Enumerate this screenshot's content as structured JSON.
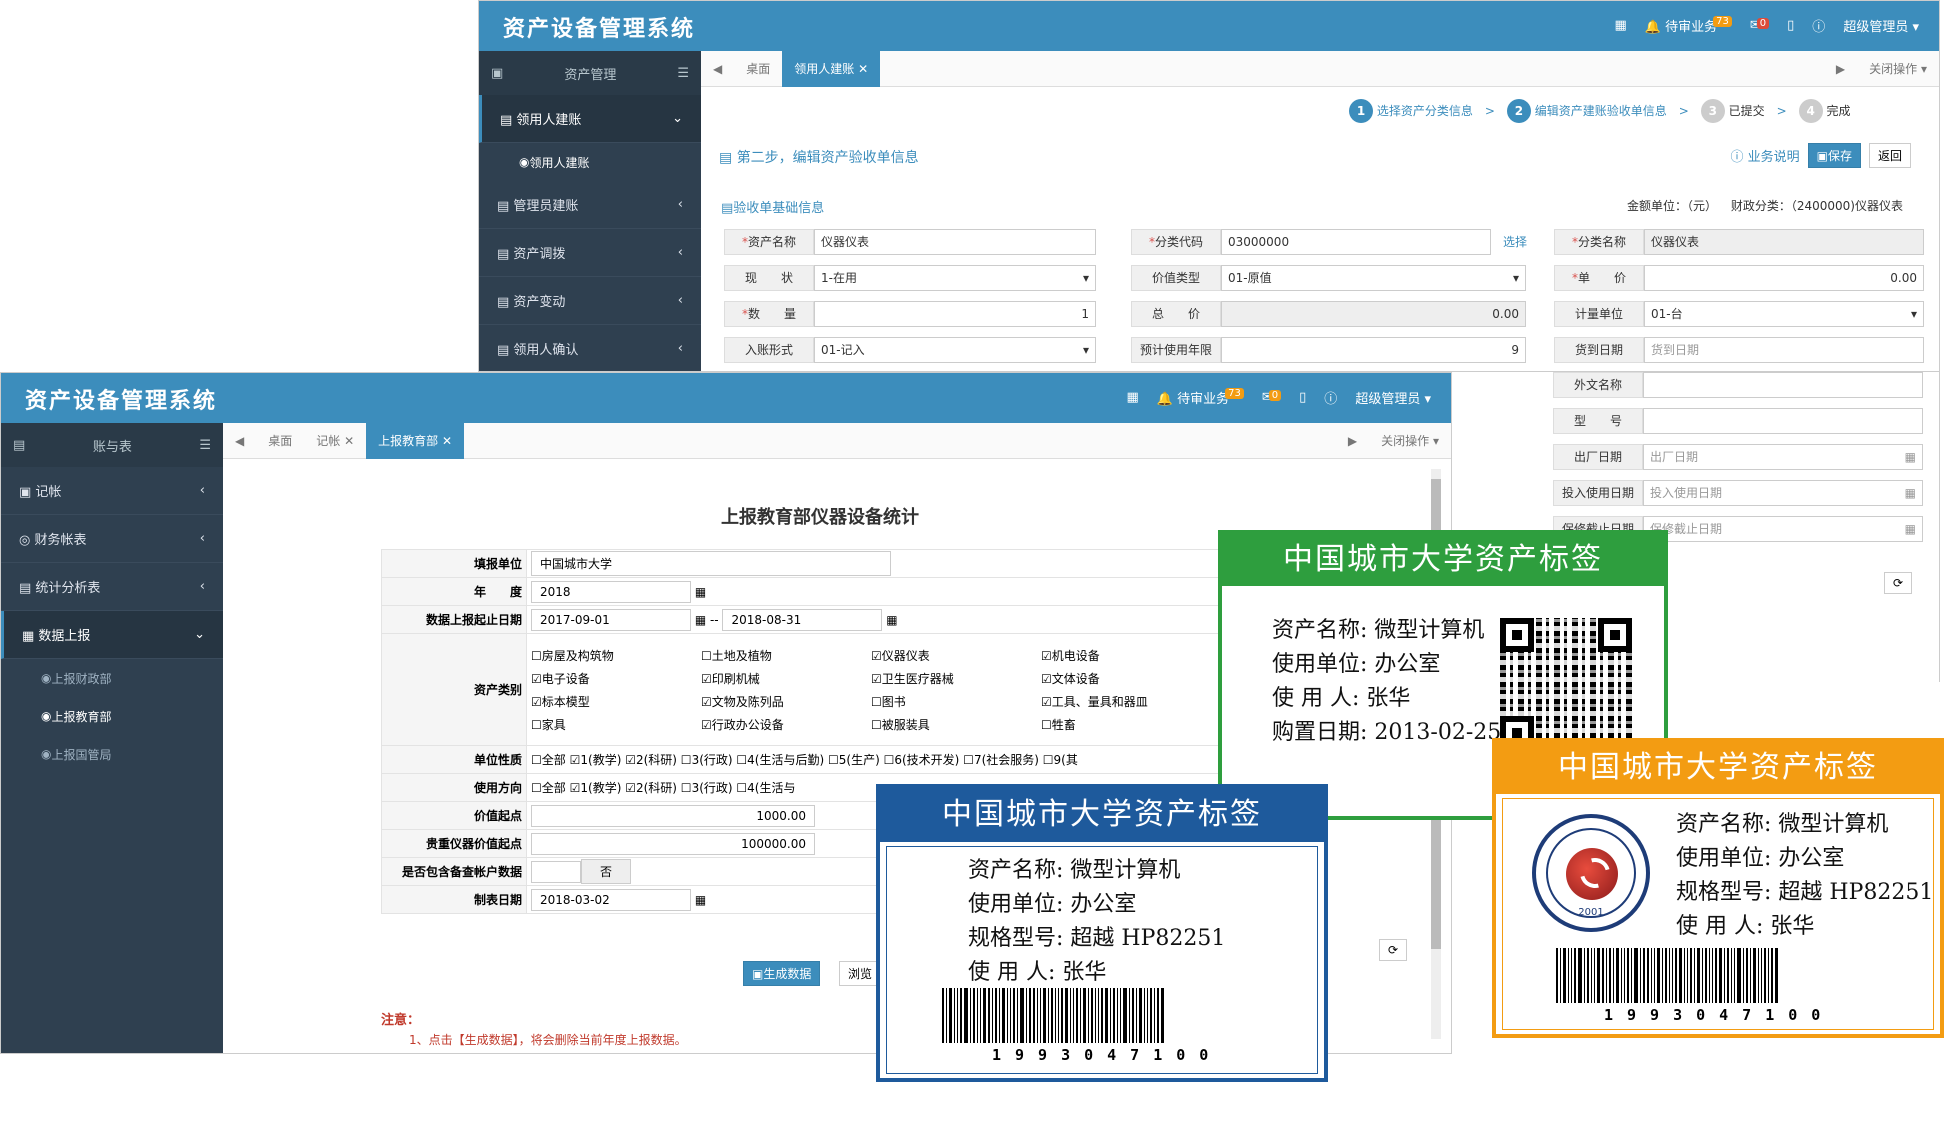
{
  "back": {
    "app_title": "资产设备管理系统",
    "pending": "待审业务",
    "pending_count": "73",
    "mail_count": "0",
    "user": "超级管理员",
    "sidebar_head": "资产管理",
    "sidebar": [
      {
        "label": "领用人建账",
        "sub": [
          "领用人建账"
        ]
      },
      {
        "label": "管理员建账"
      },
      {
        "label": "资产调拨"
      },
      {
        "label": "资产变动"
      },
      {
        "label": "领用人确认"
      }
    ],
    "tabs": [
      "桌面",
      "领用人建账"
    ],
    "close_ops": "关闭操作",
    "steps": [
      {
        "n": "1",
        "label": "选择资产分类信息"
      },
      {
        "n": "2",
        "label": "编辑资产建账验收单信息"
      },
      {
        "n": "3",
        "label": "已提交"
      },
      {
        "n": "4",
        "label": "完成"
      }
    ],
    "step_title": "第二步，编辑资产验收单信息",
    "help": "业务说明",
    "save": "保存",
    "back_btn": "返回",
    "section": "验收单基础信息",
    "money_unit": "金额单位：（元）",
    "asset_class": "财政分类：（2400000)仪器仪表",
    "select": "选择",
    "fields": {
      "asset_name_l": "资产名称",
      "asset_name": "仪器仪表",
      "status_l": "现　　状",
      "status": "1-在用",
      "qty_l": "数　　量",
      "qty": "1",
      "entry_l": "入账形式",
      "entry": "01-记入",
      "class_code_l": "分类代码",
      "class_code": "03000000",
      "value_type_l": "价值类型",
      "value_type": "01-原值",
      "total_l": "总　　价",
      "total": "0.00",
      "years_l": "预计使用年限",
      "years": "9",
      "class_name_l": "分类名称",
      "class_name": "仪器仪表",
      "price_l": "单　　价",
      "price": "0.00",
      "unit_l": "计量单位",
      "unit": "01-台",
      "arrive_l": "货到日期",
      "arrive": "货到日期",
      "foreign_l": "外文名称",
      "model_l": "型　　号",
      "mfg_l": "出厂日期",
      "mfg": "出厂日期",
      "use_l": "投入使用日期",
      "use": "投入使用日期",
      "warranty_l": "保修截止日期",
      "warranty": "保修截止日期"
    }
  },
  "front": {
    "app_title": "资产设备管理系统",
    "pending": "待审业务",
    "pending_count": "73",
    "mail_count": "0",
    "user": "超级管理员",
    "sidebar_head": "账与表",
    "sidebar": [
      "记帐",
      "财务帐表",
      "统计分析表",
      "数据上报"
    ],
    "subs": [
      "上报财政部",
      "上报教育部",
      "上报国管局"
    ],
    "tabs": [
      "桌面",
      "记帐",
      "上报教育部"
    ],
    "close_ops": "关闭操作",
    "report_title": "上报教育部仪器设备统计",
    "rows": {
      "unit_l": "填报单位",
      "unit": "中国城市大学",
      "year_l": "年　　度",
      "year": "2018",
      "range_l": "数据上报起止日期",
      "from": "2017-09-01",
      "sep": "--",
      "to": "2018-08-31",
      "cat_l": "资产类别",
      "cats": [
        "房屋及构筑物",
        "土地及植物",
        "仪器仪表",
        "机电设备",
        "电子设备",
        "印刷机械",
        "卫生医疗器械",
        "文体设备",
        "标本模型",
        "文物及陈列品",
        "图书",
        "工具、量具和器皿",
        "家具",
        "行政办公设备",
        "被服装具",
        "牲畜"
      ],
      "nature_l": "单位性质",
      "natures": [
        "全部",
        "1(教学)",
        "2(科研)",
        "3(行政)",
        "4(生活与后勤)",
        "5(生产)",
        "6(技术开发)",
        "7(社会服务)",
        "9(其"
      ],
      "dir_l": "使用方向",
      "dirs": [
        "全部",
        "1(教学)",
        "2(科研)",
        "3(行政)",
        "4(生活与"
      ],
      "start_l": "价值起点",
      "start": "1000.00",
      "heavy_l": "贵重仪器价值起点",
      "heavy": "100000.00",
      "incl_l": "是否包含备查帐户数据",
      "incl": "否",
      "date_l": "制表日期",
      "date": "2018-03-02"
    },
    "gen_btn": "生成数据",
    "browse_btn": "浏览",
    "note_title": "注意：",
    "note1": "1、点击【生成数据】，将会删除当前年度上报数据。"
  },
  "cards": {
    "title": "中国城市大学资产标签",
    "green": {
      "l1": "资产名称: 微型计算机",
      "l2": "使用单位: 办公室",
      "l3": "使 用 人: 张华",
      "l4": "购置日期: 2013-02-25"
    },
    "blue": {
      "l1": "资产名称: 微型计算机",
      "l2": "使用单位: 办公室",
      "l3": "规格型号: 超越 HP82251",
      "l4": "使 用 人: 张华",
      "code": "1993047100"
    },
    "orange": {
      "l1": "资产名称: 微型计算机",
      "l2": "使用单位: 办公室",
      "l3": "规格型号: 超越 HP82251",
      "l4": "使 用 人: 张华",
      "code": "1993047100",
      "seal_text": "TIANJIN MODERN VOCATIONAL TECHNOLOGY COLLEGE",
      "seal_year": "2001"
    }
  },
  "colors": {
    "header": "#3c8dbc",
    "sidebar": "#2f4050",
    "green": "#2e9e3e",
    "blue": "#1e5a9c",
    "orange": "#f39c12"
  }
}
